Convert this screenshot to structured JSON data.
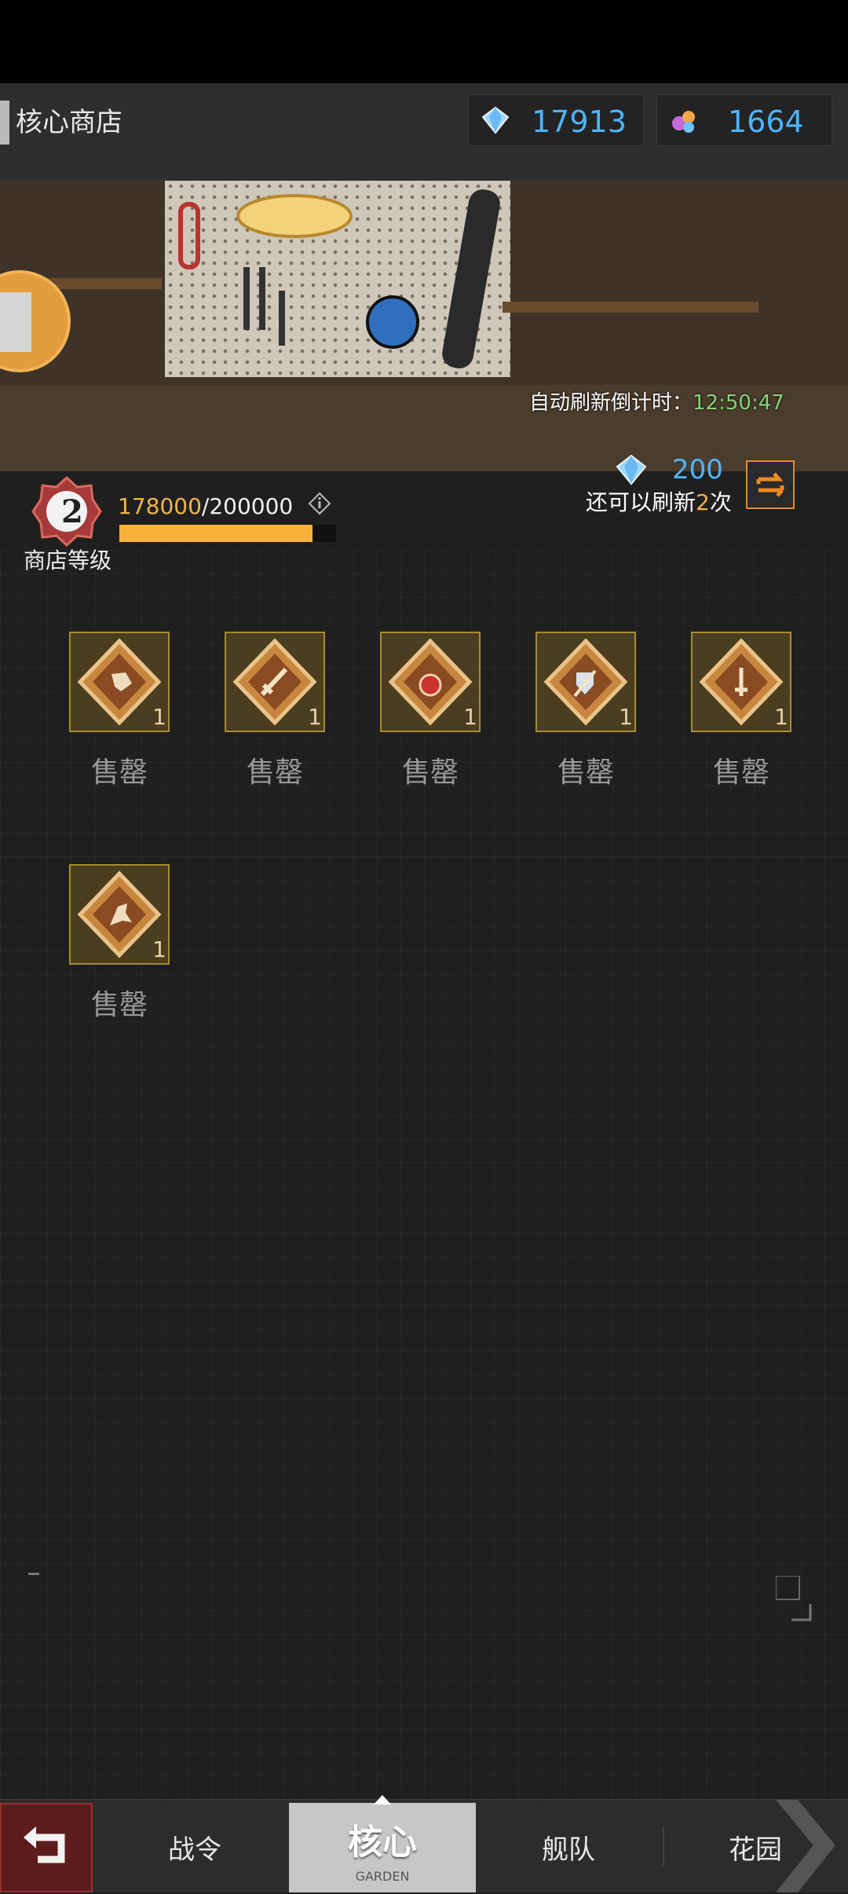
{
  "header": {
    "title": "核心商店",
    "currencies": [
      {
        "icon": "diamond-icon",
        "value": "17913"
      },
      {
        "icon": "gem-cluster-icon",
        "value": "1664"
      }
    ]
  },
  "banner": {
    "refresh_label": "自动刷新倒计时：",
    "refresh_time": "12:50:47"
  },
  "shop_level": {
    "level": "2",
    "label": "商店等级",
    "exp_current": "178000",
    "exp_separator": "/",
    "exp_max": "200000",
    "progress": 0.89
  },
  "refresh": {
    "cost": "200",
    "remaining_prefix": "还可以刷新",
    "remaining_count": "2",
    "remaining_suffix": "次"
  },
  "items": [
    {
      "icon": "running-figure-badge-icon",
      "qty": "1",
      "status": "售罄"
    },
    {
      "icon": "sword-badge-icon",
      "qty": "1",
      "status": "售罄"
    },
    {
      "icon": "heart-potion-badge-icon",
      "qty": "1",
      "status": "售罄"
    },
    {
      "icon": "shield-sword-badge-icon",
      "qty": "1",
      "status": "售罄"
    },
    {
      "icon": "dagger-badge-icon",
      "qty": "1",
      "status": "售罄"
    },
    {
      "icon": "running-figure-badge-icon",
      "qty": "1",
      "status": "售罄"
    }
  ],
  "nav": {
    "back_icon": "back-arrow-icon",
    "tabs": [
      {
        "label": "战令"
      },
      {
        "label": "核心",
        "sub": "GARDEN"
      },
      {
        "label": "舰队"
      },
      {
        "label": "花园"
      }
    ]
  },
  "colors": {
    "accent_blue": "#4fb4ff",
    "accent_gold": "#f1b64b",
    "timer_green": "#86d47a",
    "sold_grey": "#9a9a9a"
  }
}
